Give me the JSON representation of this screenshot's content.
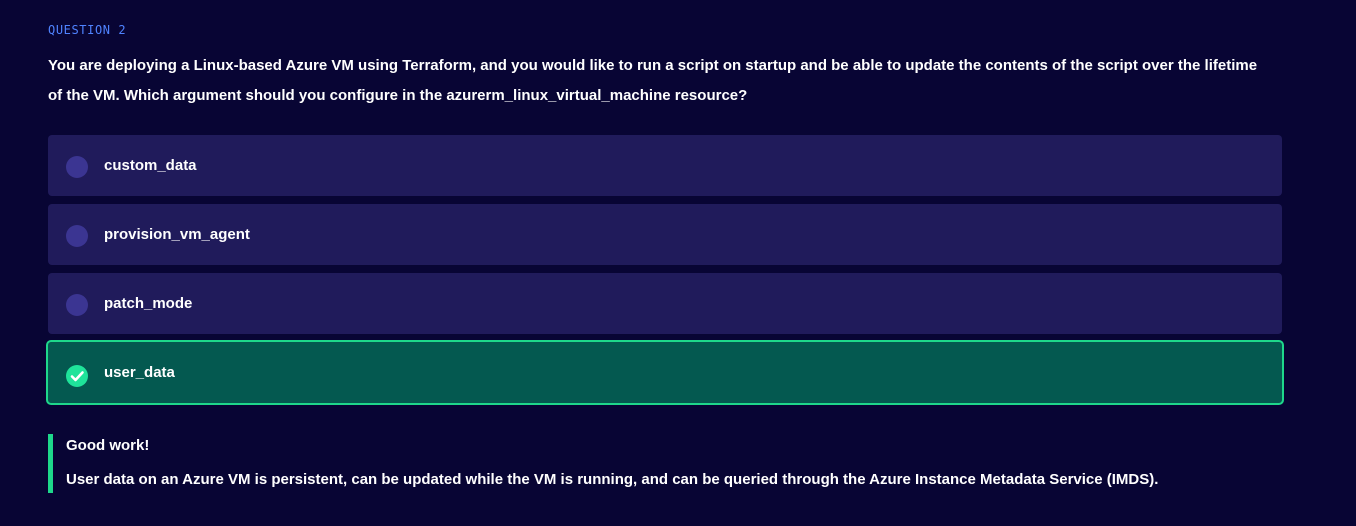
{
  "question": {
    "label": "QUESTION 2",
    "text": "You are deploying a Linux-based Azure VM using Terraform, and you would like to run a script on startup and be able to update the contents of the script over the lifetime of the VM. Which argument should you configure in the azurerm_linux_virtual_machine resource?"
  },
  "options": [
    {
      "label": "custom_data",
      "state": "unselected"
    },
    {
      "label": "provision_vm_agent",
      "state": "unselected"
    },
    {
      "label": "patch_mode",
      "state": "unselected"
    },
    {
      "label": "user_data",
      "state": "correct"
    }
  ],
  "feedback": {
    "title": "Good work!",
    "text": "User data on an Azure VM is persistent, can be updated while the VM is running, and can be queried through the Azure Instance Metadata Service (IMDS)."
  },
  "colors": {
    "background": "#080534",
    "option_bg": "#201b5b",
    "correct_bg": "#045950",
    "correct_accent": "#1ed88b",
    "question_label": "#4f83ff"
  },
  "icons": {
    "radio": "radio-unselected-icon",
    "check": "check-circle-icon"
  }
}
